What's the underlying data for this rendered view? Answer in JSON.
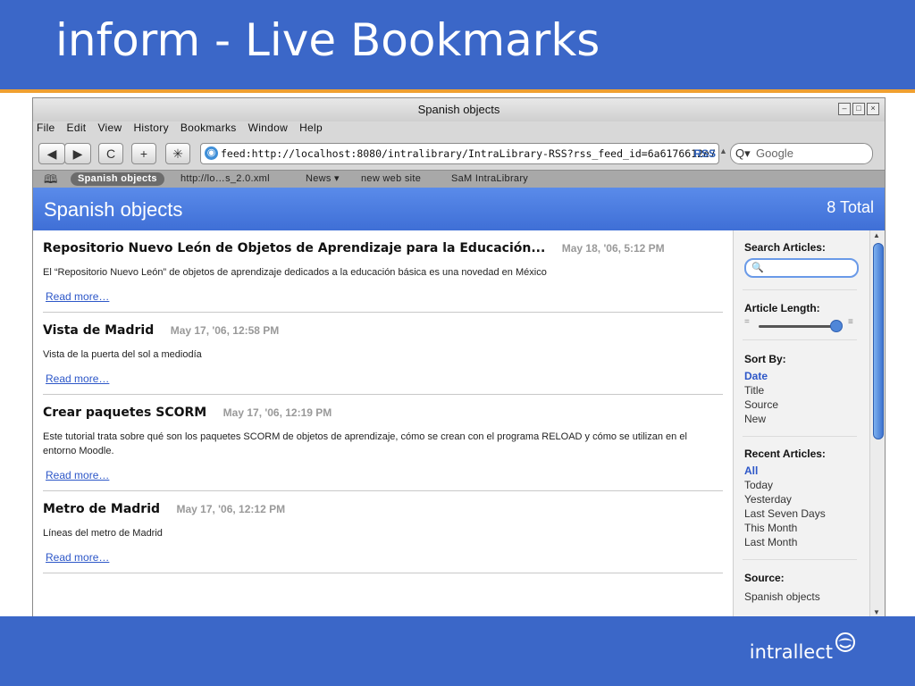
{
  "slide": {
    "title": "inform - Live Bookmarks",
    "logo_text": "intrallect",
    "header_color": "#3b67c8",
    "accent_color": "#f0a030"
  },
  "window": {
    "title": "Spanish objects",
    "controls": [
      "minimize-icon",
      "maximize-icon",
      "close-icon"
    ]
  },
  "menu": [
    "File",
    "Edit",
    "View",
    "History",
    "Bookmarks",
    "Window",
    "Help"
  ],
  "toolbar": {
    "back_label": "◀",
    "forward_label": "▶",
    "reload_label": "C",
    "add_label": "+",
    "bug_label": "✳",
    "url": "feed:http://localhost:8080/intralibrary/IntraLibrary-RSS?rss_feed_id=6a6176612e7",
    "rss_label": "RSS",
    "search_placeholder": "Google",
    "search_prefix": "Q▾"
  },
  "bookmarks": [
    {
      "label": "Spanish objects",
      "active": true
    },
    {
      "label": "http://lo…s_2.0.xml",
      "active": false
    },
    {
      "label": "News ▾",
      "active": false
    },
    {
      "label": "new web site",
      "active": false
    },
    {
      "label": "SaM IntraLibrary",
      "active": false
    }
  ],
  "feed": {
    "title": "Spanish objects",
    "total": "8 Total",
    "read_more": "Read more…",
    "articles": [
      {
        "title": "Repositorio Nuevo León de Objetos de Aprendizaje para la Educación...",
        "date": "May 18, '06, 5:12 PM",
        "desc": "El “Repositorio Nuevo León” de objetos de aprendizaje dedicados a la educación básica es una novedad en México"
      },
      {
        "title": "Vista de Madrid",
        "date": "May 17, '06, 12:58 PM",
        "desc": "Vista de la puerta del sol a mediodía"
      },
      {
        "title": "Crear paquetes SCORM",
        "date": "May 17, '06, 12:19 PM",
        "desc": "Este tutorial trata sobre qué son los paquetes SCORM de objetos de aprendizaje, cómo se crean con el programa RELOAD y cómo se utilizan en el entorno Moodle."
      },
      {
        "title": "Metro de Madrid",
        "date": "May 17, '06, 12:12 PM",
        "desc": "Líneas del metro de Madrid"
      }
    ]
  },
  "sidebar": {
    "search_title": "Search Articles:",
    "length_title": "Article Length:",
    "length_level": 0.95,
    "sort_title": "Sort By:",
    "sort_options": [
      "Date",
      "Title",
      "Source",
      "New"
    ],
    "sort_active": "Date",
    "recent_title": "Recent Articles:",
    "recent_options": [
      "All",
      "Today",
      "Yesterday",
      "Last Seven Days",
      "This Month",
      "Last Month"
    ],
    "recent_active": "All",
    "source_title": "Source:",
    "source_value": "Spanish objects"
  }
}
